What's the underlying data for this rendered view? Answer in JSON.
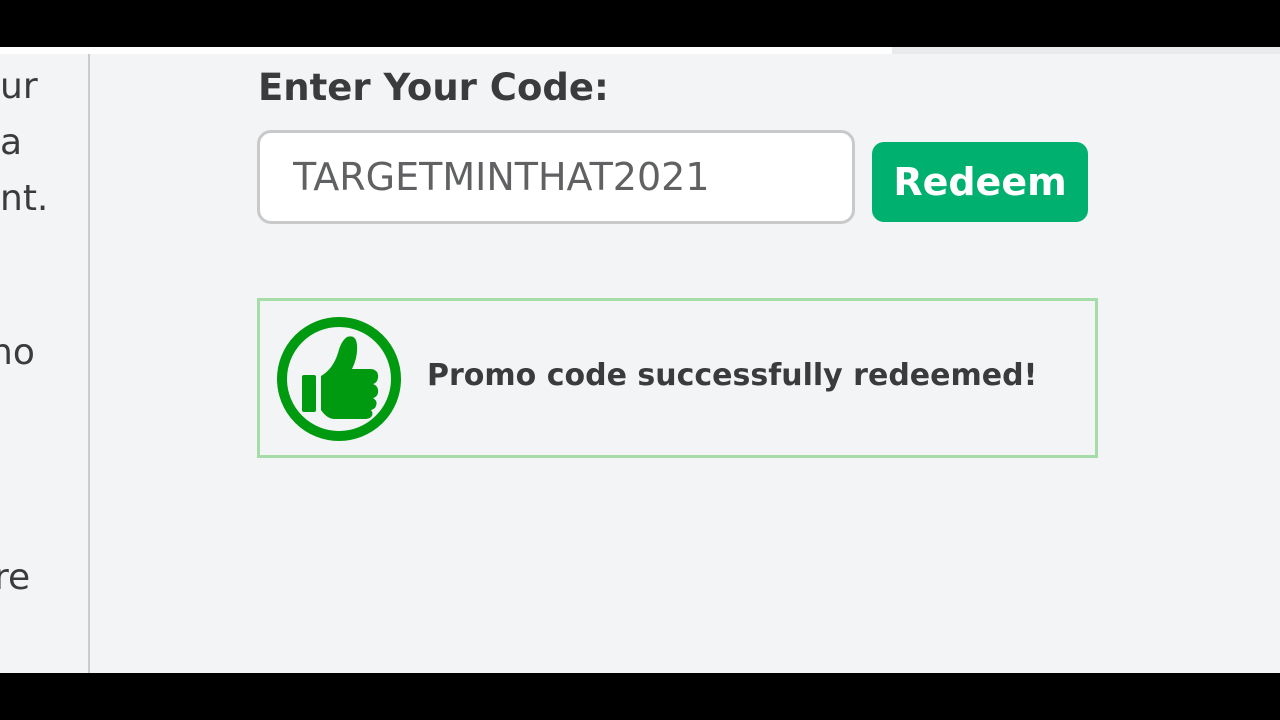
{
  "redeem_form": {
    "heading": "Enter Your Code:",
    "code_value": "TARGETMINTHAT2021",
    "redeem_label": "Redeem"
  },
  "success_message": {
    "text": "Promo code successfully redeemed!",
    "icon": "thumbs-up-icon"
  },
  "left_panel": {
    "fragments": [
      "ur",
      "a",
      "nt.",
      "no",
      ".",
      "re"
    ]
  },
  "colors": {
    "accent_green": "#00b06f",
    "icon_green": "#009a10",
    "success_border": "#a6dca8",
    "page_background": "#f2f4f5",
    "text": "#393b3d"
  }
}
